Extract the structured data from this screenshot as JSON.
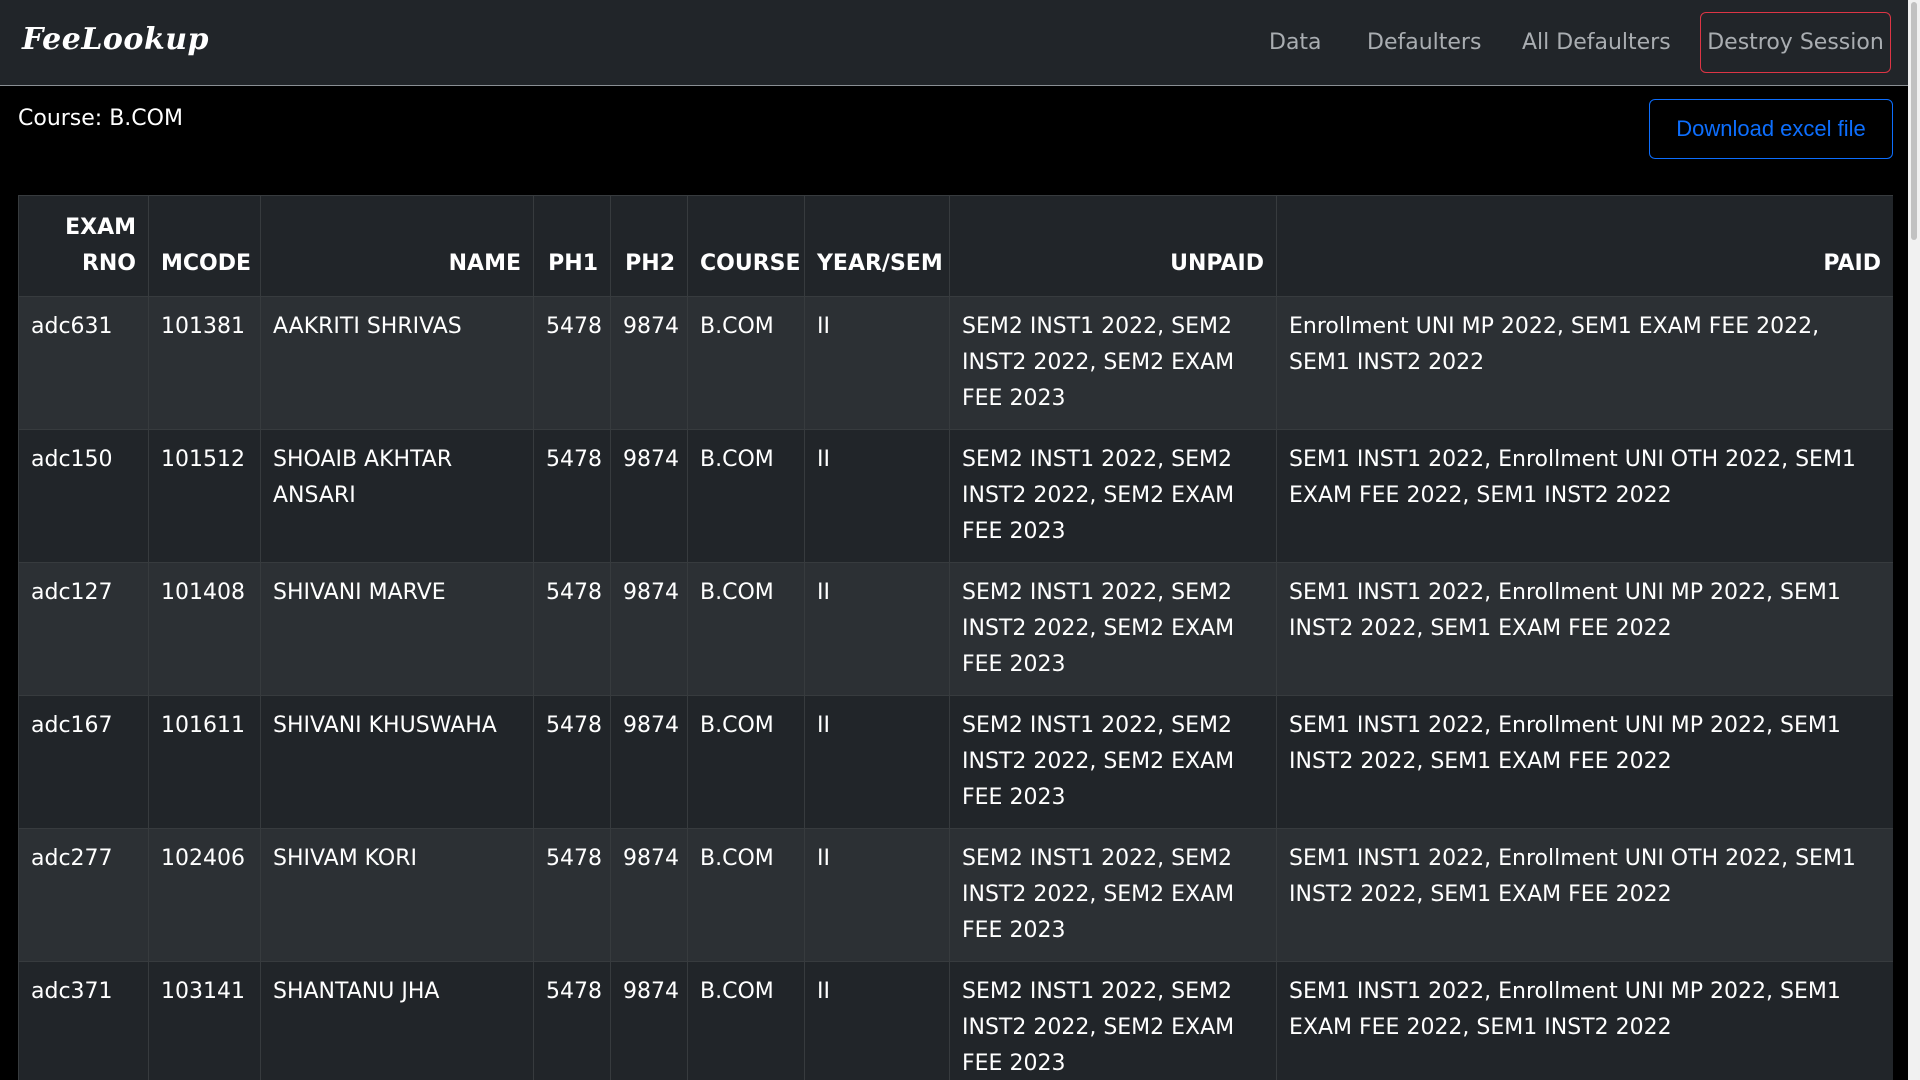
{
  "navbar": {
    "brand": "FeeLookup",
    "links": [
      "Data",
      "Defaulters",
      "All Defaulters"
    ],
    "destroy_label": "Destroy Session"
  },
  "course": {
    "label": "Course: B.COM"
  },
  "download_label": "Download excel file",
  "table": {
    "headers": [
      "EXAM RNO",
      "MCODE",
      "NAME",
      "PH1",
      "PH2",
      "COURSE",
      "YEAR/SEM",
      "UNPAID",
      "PAID"
    ],
    "rows": [
      [
        "adc631",
        "101381",
        "AAKRITI SHRIVAS",
        "5478",
        "9874",
        "B.COM",
        "II",
        "SEM2 INST1 2022, SEM2 INST2 2022, SEM2 EXAM FEE 2023",
        "Enrollment UNI MP 2022, SEM1 EXAM FEE 2022, SEM1 INST2 2022"
      ],
      [
        "adc150",
        "101512",
        "SHOAIB AKHTAR ANSARI",
        "5478",
        "9874",
        "B.COM",
        "II",
        "SEM2 INST1 2022, SEM2 INST2 2022, SEM2 EXAM FEE 2023",
        "SEM1 INST1 2022, Enrollment UNI OTH 2022, SEM1 EXAM FEE 2022, SEM1 INST2 2022"
      ],
      [
        "adc127",
        "101408",
        "SHIVANI MARVE",
        "5478",
        "9874",
        "B.COM",
        "II",
        "SEM2 INST1 2022, SEM2 INST2 2022, SEM2 EXAM FEE 2023",
        "SEM1 INST1 2022, Enrollment UNI MP 2022, SEM1 INST2 2022, SEM1 EXAM FEE 2022"
      ],
      [
        "adc167",
        "101611",
        "SHIVANI KHUSWAHA",
        "5478",
        "9874",
        "B.COM",
        "II",
        "SEM2 INST1 2022, SEM2 INST2 2022, SEM2 EXAM FEE 2023",
        "SEM1 INST1 2022, Enrollment UNI MP 2022, SEM1 INST2 2022, SEM1 EXAM FEE 2022"
      ],
      [
        "adc277",
        "102406",
        "SHIVAM KORI",
        "5478",
        "9874",
        "B.COM",
        "II",
        "SEM2 INST1 2022, SEM2 INST2 2022, SEM2 EXAM FEE 2023",
        "SEM1 INST1 2022, Enrollment UNI OTH 2022, SEM1 INST2 2022, SEM1 EXAM FEE 2022"
      ],
      [
        "adc371",
        "103141",
        "SHANTANU JHA",
        "5478",
        "9874",
        "B.COM",
        "II",
        "SEM2 INST1 2022, SEM2 INST2 2022, SEM2 EXAM FEE 2023",
        "SEM1 INST1 2022, Enrollment UNI MP 2022, SEM1 EXAM FEE 2022, SEM1 INST2 2022"
      ]
    ]
  },
  "colors": {
    "navbar_bg": "#212529",
    "page_bg": "#000000",
    "danger": "#dc3545",
    "primary": "#0d6efd"
  }
}
